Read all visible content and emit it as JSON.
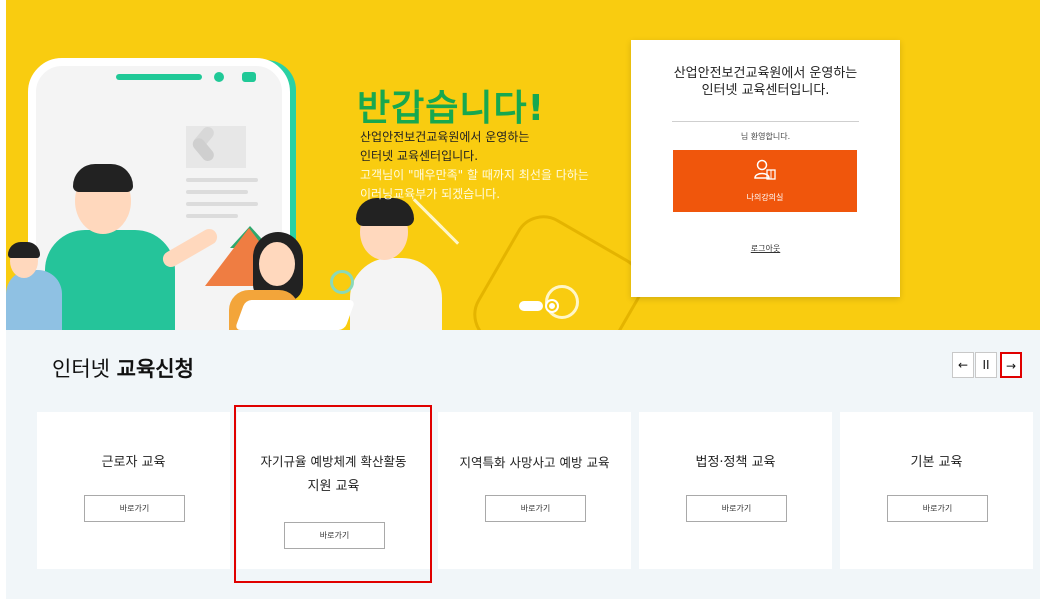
{
  "hero": {
    "title": "반갑습니다!",
    "desc_line1": "산업안전보건교육원에서 운영하는",
    "desc_line2": "인터넷 교육센터입니다.",
    "desc_line3": "고객님이 \"매우만족\" 할 때까지 최선을 다하는",
    "desc_line4": "이러닝교육부가 되겠습니다."
  },
  "login_card": {
    "title_line1": "산업안전보건교육원에서 운영하는",
    "title_line2": "인터넷 교육센터입니다.",
    "welcome": "님 환영합니다.",
    "my_class_label": "나의강의실",
    "logout_label": "로그아웃"
  },
  "edu_section": {
    "title_normal": "인터넷 ",
    "title_bold": "교육신청",
    "controls": {
      "prev": "←",
      "pause": "II",
      "next": "→"
    },
    "cards": [
      {
        "title": "근로자 교육",
        "button": "바로가기"
      },
      {
        "title_line1": "자기규율 예방체계 확산활동",
        "title_line2": "지원 교육",
        "button": "바로가기"
      },
      {
        "title": "지역특화 사망사고 예방 교육",
        "button": "바로가기"
      },
      {
        "title": "법정·정책 교육",
        "button": "바로가기"
      },
      {
        "title": "기본 교육",
        "button": "바로가기"
      }
    ]
  },
  "colors": {
    "hero_bg": "#f9cc10",
    "accent_green": "#17a84f",
    "button_orange": "#f0560c",
    "highlight_red": "#e00000",
    "section_bg": "#f1f6f9"
  },
  "icons": [
    "user-book-icon",
    "arrow-left-icon",
    "pause-icon",
    "arrow-right-icon"
  ]
}
